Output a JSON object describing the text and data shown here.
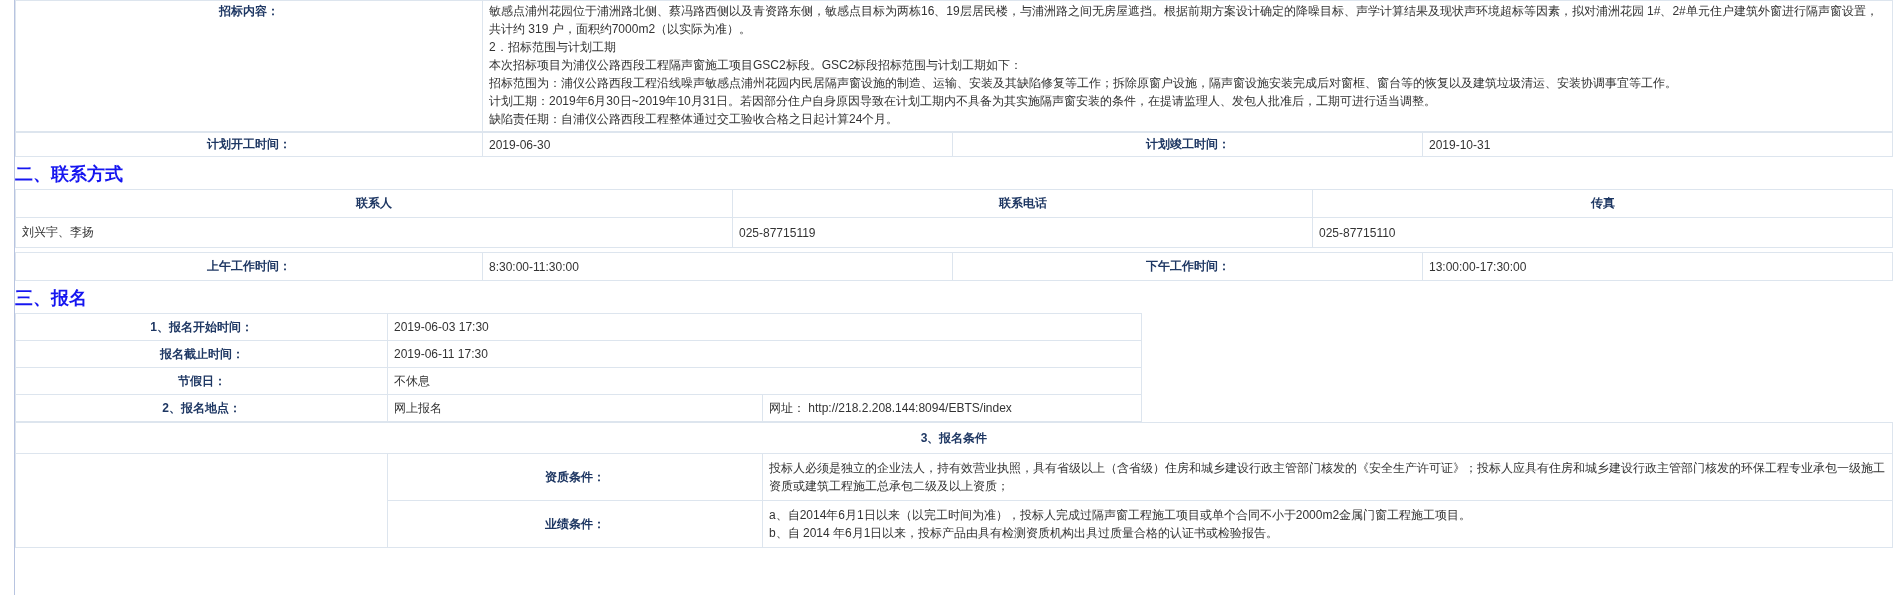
{
  "bid_content": {
    "label": "招标内容：",
    "lines": [
      "敏感点浦州花园位于浦洲路北侧、蔡冯路西侧以及青资路东侧，敏感点目标为两栋16、19层居民楼，与浦洲路之间无房屋遮挡。根据前期方案设计确定的降噪目标、声学计算结果及现状声环境超标等因素，拟对浦洲花园 1#、2#单元住户建筑外窗进行隔声窗设置，",
      "共计约 319 户，面积约7000m2（以实际为准）。",
      "2．招标范围与计划工期",
      "本次招标项目为浦仪公路西段工程隔声窗施工项目GSC2标段。GSC2标段招标范围与计划工期如下：",
      "招标范围为：浦仪公路西段工程沿线噪声敏感点浦州花园内民居隔声窗设施的制造、运输、安装及其缺陷修复等工作；拆除原窗户设施，隔声窗设施安装完成后对窗框、窗台等的恢复以及建筑垃圾清运、安装协调事宜等工作。",
      "计划工期：2019年6月30日~2019年10月31日。若因部分住户自身原因导致在计划工期内不具备为其实施隔声窗安装的条件，在提请监理人、发包人批准后，工期可进行适当调整。",
      "缺陷责任期：自浦仪公路西段工程整体通过交工验收合格之日起计算24个月。"
    ]
  },
  "schedule": [
    {
      "label": "计划开工时间：",
      "value": "2019-06-30"
    },
    {
      "label": "计划竣工时间：",
      "value": "2019-10-31"
    }
  ],
  "contact_section": {
    "heading": "二、联系方式",
    "columns": [
      "联系人",
      "联系电话",
      "传真"
    ],
    "row": [
      "刘兴宇、李扬",
      "025-87715119",
      "025-87715110"
    ],
    "work_hours": [
      {
        "label": "上午工作时间：",
        "value": "8:30:00-11:30:00"
      },
      {
        "label": "下午工作时间：",
        "value": "13:00:00-17:30:00"
      }
    ]
  },
  "registration_section": {
    "heading": "三、报名",
    "rows": [
      {
        "label": "1、报名开始时间：",
        "value": "2019-06-03 17:30"
      },
      {
        "label": "报名截止时间：",
        "value": "2019-06-11 17:30"
      },
      {
        "label": "节假日：",
        "value": "不休息"
      }
    ],
    "location": {
      "label": "2、报名地点：",
      "value": "网上报名",
      "url": "网址： http://218.2.208.144:8094/EBTS/index"
    },
    "conditions": {
      "title": "3、报名条件",
      "items": [
        {
          "label": "资质条件：",
          "lines": [
            "投标人必须是独立的企业法人，持有效营业执照，具有省级以上（含省级）住房和城乡建设行政主管部门核发的《安全生产许可证》；投标人应具有住房和城乡建设行政主管部门核发的环保工程专业承包一级施工资质或建筑工程施工总承包二级及以上资质；"
          ]
        },
        {
          "label": "业绩条件：",
          "lines": [
            "a、自2014年6月1日以来（以完工时间为准），投标人完成过隔声窗工程施工项目或单个合同不小于2000m2金属门窗工程施工项目。",
            "b、自 2014 年6月1日以来，投标产品由具有检测资质机构出具过质量合格的认证书或检验报告。"
          ]
        }
      ]
    }
  }
}
